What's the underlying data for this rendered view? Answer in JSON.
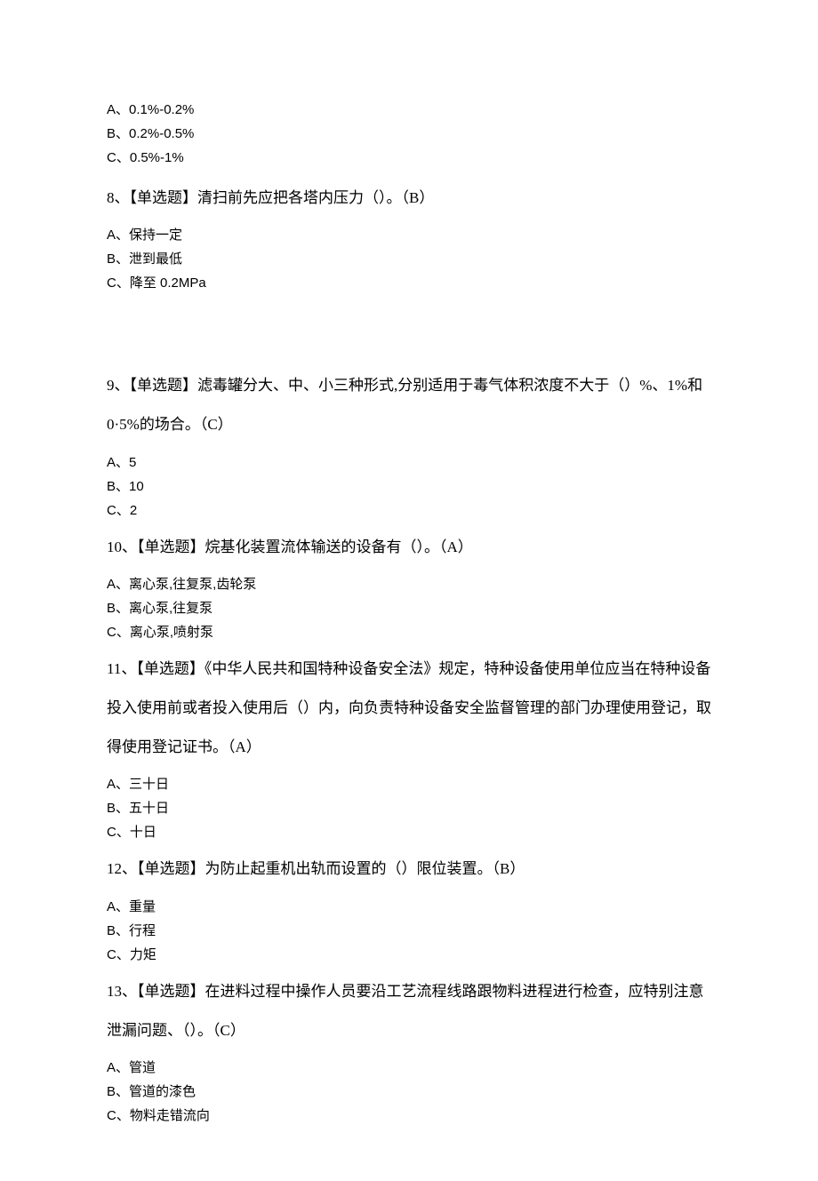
{
  "pre_options": {
    "a": "A、0.1%-0.2%",
    "b": "B、0.2%-0.5%",
    "c": "C、0.5%-1%"
  },
  "q8": {
    "text": "8、【单选题】清扫前先应把各塔内压力（）。（B）",
    "a": "A、保持一定",
    "b": "B、泄到最低",
    "c": "C、降至 0.2MPa"
  },
  "q9": {
    "text": "9、【单选题】滤毒罐分大、中、小三种形式,分别适用于毒气体积浓度不大于（）%、1%和 0·5%的场合。（C）",
    "a": "A、5",
    "b": "B、10",
    "c": "C、2"
  },
  "q10": {
    "text": "10、【单选题】烷基化装置流体输送的设备有（）。（A）",
    "a": "A、离心泵,往复泵,齿轮泵",
    "b": "B、离心泵,往复泵",
    "c": "C、离心泵,喷射泵"
  },
  "q11": {
    "text": "11、【单选题】《中华人民共和国特种设备安全法》规定，特种设备使用单位应当在特种设备投入使用前或者投入使用后（）内，向负责特种设备安全监督管理的部门办理使用登记，取得使用登记证书。（A）",
    "a": "A、三十日",
    "b": "B、五十日",
    "c": "C、十日"
  },
  "q12": {
    "text": "12、【单选题】为防止起重机出轨而设置的（）限位装置。（B）",
    "a": "A、重量",
    "b": "B、行程",
    "c": "C、力矩"
  },
  "q13": {
    "text": "13、【单选题】在进料过程中操作人员要沿工艺流程线路跟物料进程进行检查，应特别注意泄漏问题、（）。（C）",
    "a": "A、管道",
    "b": "B、管道的漆色",
    "c": "C、物料走错流向"
  }
}
